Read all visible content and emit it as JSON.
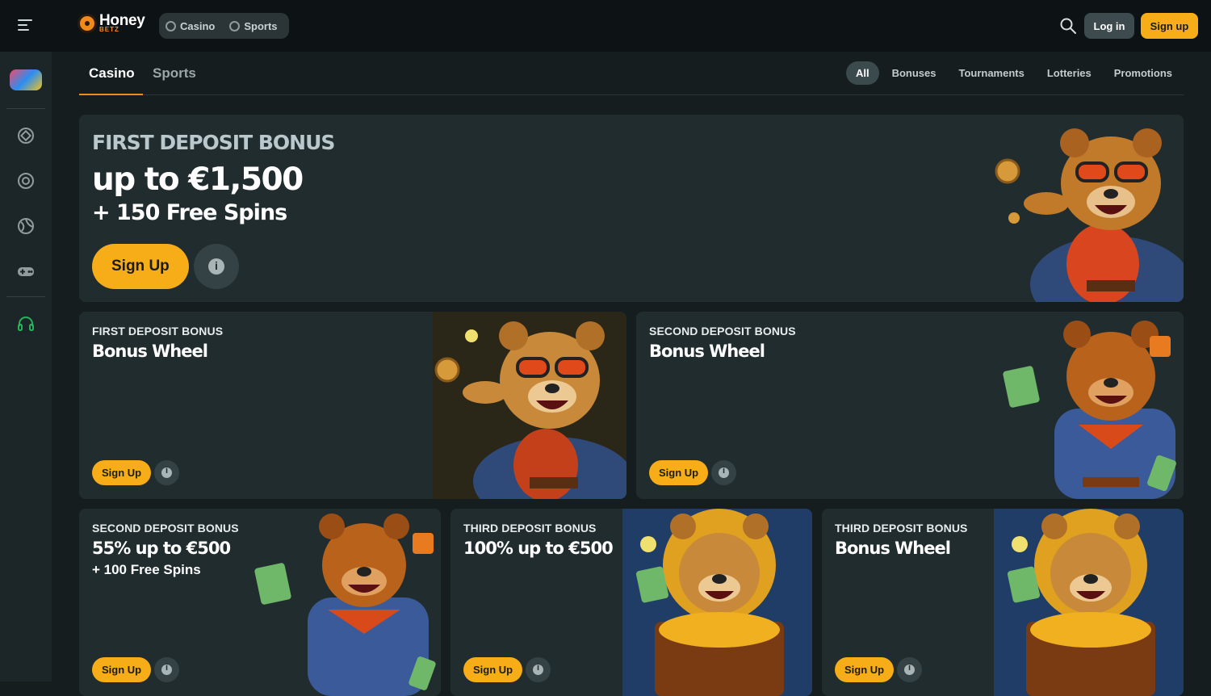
{
  "brand": {
    "name": "Honey",
    "sub": "BETZ"
  },
  "header": {
    "switch": [
      {
        "label": "Casino",
        "icon": "chip-icon"
      },
      {
        "label": "Sports",
        "icon": "ball-icon"
      }
    ],
    "login_label": "Log in",
    "signup_label": "Sign up"
  },
  "sidebar": {
    "icons": [
      "promo-icon",
      "casino-chip-icon",
      "live-casino-icon",
      "sports-ball-icon",
      "gamepad-icon",
      "support-headset-icon"
    ]
  },
  "tabs": {
    "casino": "Casino",
    "sports": "Sports"
  },
  "filters": [
    "All",
    "Bonuses",
    "Tournaments",
    "Lotteries",
    "Promotions"
  ],
  "hero": {
    "overline": "FIRST DEPOSIT BONUS",
    "headline": "up to €1,500",
    "subline": "+ 150 Free Spins",
    "cta": "Sign Up"
  },
  "cards": [
    {
      "overline": "FIRST DEPOSIT BONUS",
      "headline": "Bonus Wheel",
      "subline": "",
      "cta": "Sign Up"
    },
    {
      "overline": "SECOND DEPOSIT BONUS",
      "headline": "Bonus Wheel",
      "subline": "",
      "cta": "Sign Up"
    },
    {
      "overline": "SECOND DEPOSIT BONUS",
      "headline": "55% up to €500",
      "subline": "+ 100 Free Spins",
      "cta": "Sign Up"
    },
    {
      "overline": "THIRD DEPOSIT BONUS",
      "headline": "100% up to €500",
      "subline": "",
      "cta": "Sign Up"
    },
    {
      "overline": "THIRD DEPOSIT BONUS",
      "headline": "Bonus Wheel",
      "subline": "",
      "cta": "Sign Up"
    }
  ],
  "colors": {
    "accent": "#f7ad17",
    "bg": "#151d1f",
    "card": "#212c2e",
    "underline": "#f28a1a"
  }
}
